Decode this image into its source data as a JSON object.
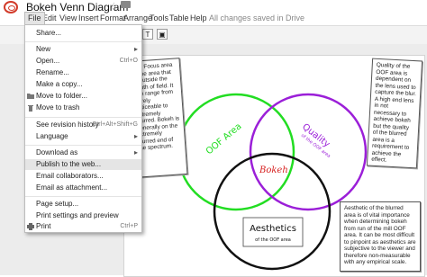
{
  "document": {
    "title": "Bokeh Venn Diagram",
    "save_status": "All changes saved in Drive"
  },
  "menubar": [
    "File",
    "Edit",
    "View",
    "Insert",
    "Format",
    "Arrange",
    "Tools",
    "Table",
    "Help"
  ],
  "file_menu": {
    "share": "Share...",
    "new": "New",
    "open": {
      "label": "Open...",
      "shortcut": "Ctrl+O"
    },
    "rename": "Rename...",
    "make_copy": "Make a copy...",
    "move_to_folder": "Move to folder...",
    "move_to_trash": "Move to trash",
    "revision_history": {
      "label": "See revision history",
      "shortcut": "Ctrl+Alt+Shift+G"
    },
    "language": "Language",
    "download_as": "Download as",
    "publish": "Publish to the web...",
    "email_collaborators": "Email collaborators...",
    "email_attachment": "Email as attachment...",
    "page_setup": "Page setup...",
    "print_settings": "Print settings and preview",
    "print": {
      "label": "Print",
      "shortcut": "Ctrl+P"
    }
  },
  "diagram": {
    "circles": {
      "oof_area": {
        "label": "OOF Area",
        "color": "#22dd22"
      },
      "quality": {
        "label": "Quality",
        "sublabel": "of the OOF area",
        "color": "#9b1fd8"
      },
      "aesthetics": {
        "label": "Aesthetics",
        "sublabel": "of the OOF area",
        "color": "#111111"
      },
      "center": {
        "label": "Bokeh",
        "color": "#d6201f"
      }
    },
    "notes": {
      "left": "...of Focus area is the area that is outside the depth of field. It can range from barely noticeable to extremely blurred. Bokeh is generally on the extremely blurred end of the spectrum.",
      "right": "Quality of the OOF area is dependent on the lens used to capture the blur. A high end lens in not necessary to achieve bokeh but the quality of the blurred area is a requirement to achieve the effect.",
      "bottom": "Aesthetic of the blurred area is of vital importance when determining bokeh from run of the mill OOF area. It can be most difficult to pinpoint as aesthetics are subjective to the viewer and therefore non-measurable with any empirical scale."
    }
  }
}
